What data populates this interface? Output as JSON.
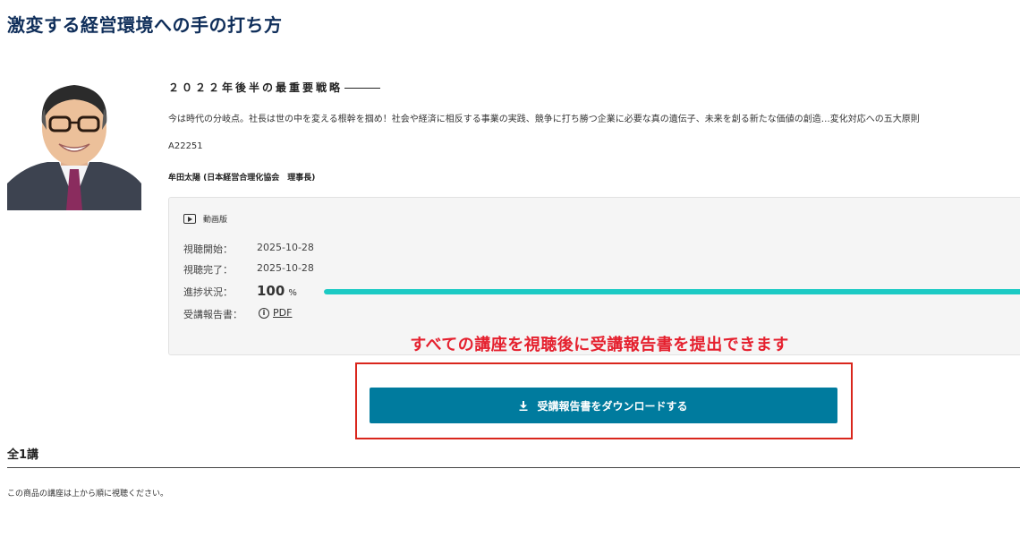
{
  "page": {
    "title": "激変する経営環境への手の打ち方"
  },
  "course": {
    "heading": "２０２２年後半の最重要戦略",
    "description": "今は時代の分岐点。社長は世の中を変える根幹を掴め！社会や経済に相反する事業の実践、競争に打ち勝つ企業に必要な真の遺伝子、未来を創る新たな価値の創造…変化対応への五大原則",
    "code": "A22251",
    "lecturer": "牟田太陽 (日本経営合理化協会　理事長)"
  },
  "info": {
    "format_label": "動画版",
    "start_label": "視聴開始：",
    "start_value": "2025-10-28",
    "end_label": "視聴完了：",
    "end_value": "2025-10-28",
    "progress_label": "進捗状況：",
    "progress_value": "100",
    "progress_unit": "%",
    "progress_fraction": 1.0,
    "report_label": "受講報告書：",
    "report_link": "PDF",
    "progress_color": "#1ccac4"
  },
  "notice": "すべての講座を視聴後に受講報告書を提出できます",
  "download_button": {
    "label": "受講報告書をダウンロードする",
    "icon": "download-icon",
    "color": "#007b9e"
  },
  "lessons": {
    "total": "全1講",
    "instruction": "この商品の講座は上から順に視聴ください。"
  },
  "colors": {
    "title": "#0f2e5a",
    "notice": "#e5202e",
    "frame": "#d9261c"
  }
}
